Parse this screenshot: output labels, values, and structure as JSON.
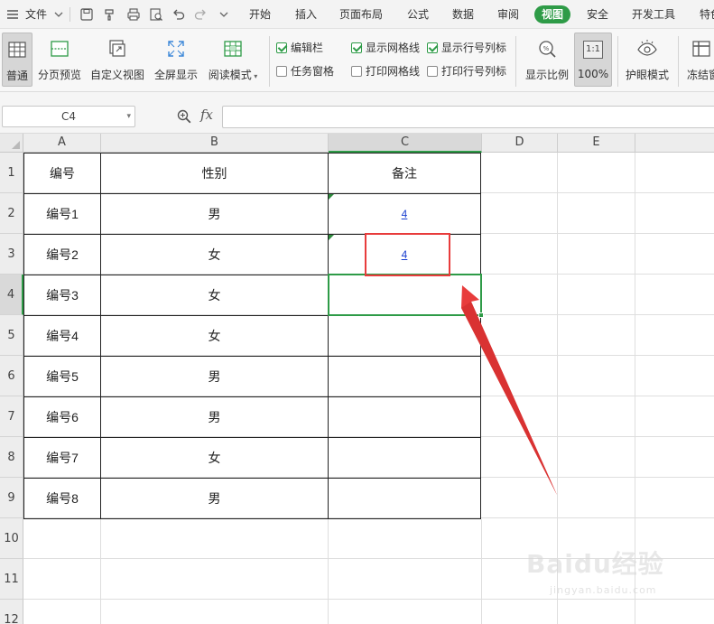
{
  "menubar": {
    "file_label": "文件",
    "tabs": [
      {
        "label": "开始"
      },
      {
        "label": "插入"
      },
      {
        "label": "页面布局"
      },
      {
        "label": "公式"
      },
      {
        "label": "数据"
      },
      {
        "label": "审阅"
      },
      {
        "label": "视图",
        "active": true
      },
      {
        "label": "安全"
      },
      {
        "label": "开发工具"
      },
      {
        "label": "特色"
      }
    ]
  },
  "ribbon": {
    "buttons": [
      {
        "label": "普通",
        "icon": "normal-view-icon",
        "selected": true
      },
      {
        "label": "分页预览",
        "icon": "page-break-preview-icon"
      },
      {
        "label": "自定义视图",
        "icon": "custom-view-icon"
      },
      {
        "label": "全屏显示",
        "icon": "fullscreen-icon"
      },
      {
        "label": "阅读模式",
        "icon": "reading-mode-icon",
        "has_dropdown": true
      },
      {
        "label": "显示比例",
        "icon": "zoom-ratio-icon"
      },
      {
        "label": "100%",
        "icon": "zoom-100-icon",
        "selected": true
      },
      {
        "label": "护眼模式",
        "icon": "eye-icon"
      },
      {
        "label": "冻结窗",
        "icon": "freeze-panes-icon"
      }
    ],
    "checkboxes": [
      {
        "label": "编辑栏",
        "checked": true
      },
      {
        "label": "任务窗格",
        "checked": false
      },
      {
        "label": "显示网格线",
        "checked": true
      },
      {
        "label": "打印网格线",
        "checked": false
      },
      {
        "label": "显示行号列标",
        "checked": true
      },
      {
        "label": "打印行号列标",
        "checked": false
      }
    ],
    "zoom_box_text": "1:1"
  },
  "formula_bar": {
    "name_box": "C4",
    "fx_label": "fx",
    "formula_value": ""
  },
  "sheet": {
    "columns": [
      "A",
      "B",
      "C",
      "D",
      "E"
    ],
    "selected_column": "C",
    "selected_row": "4",
    "rows": [
      "1",
      "2",
      "3",
      "4",
      "5",
      "6",
      "7",
      "8",
      "9",
      "10",
      "11",
      "12"
    ],
    "header_row": [
      "编号",
      "性别",
      "备注"
    ],
    "data": [
      {
        "a": "编号1",
        "b": "男",
        "c": "4",
        "c_link": true
      },
      {
        "a": "编号2",
        "b": "女",
        "c": "4",
        "c_link": true
      },
      {
        "a": "编号3",
        "b": "女",
        "c": ""
      },
      {
        "a": "编号4",
        "b": "女",
        "c": ""
      },
      {
        "a": "编号5",
        "b": "男",
        "c": ""
      },
      {
        "a": "编号6",
        "b": "男",
        "c": ""
      },
      {
        "a": "编号7",
        "b": "女",
        "c": ""
      },
      {
        "a": "编号8",
        "b": "男",
        "c": ""
      }
    ]
  },
  "annotation": {
    "highlight_color": "#e83c3c",
    "selection_color": "#2e9b47"
  },
  "watermark": {
    "logo": "Baidu经验",
    "url": "jingyan.baidu.com"
  }
}
